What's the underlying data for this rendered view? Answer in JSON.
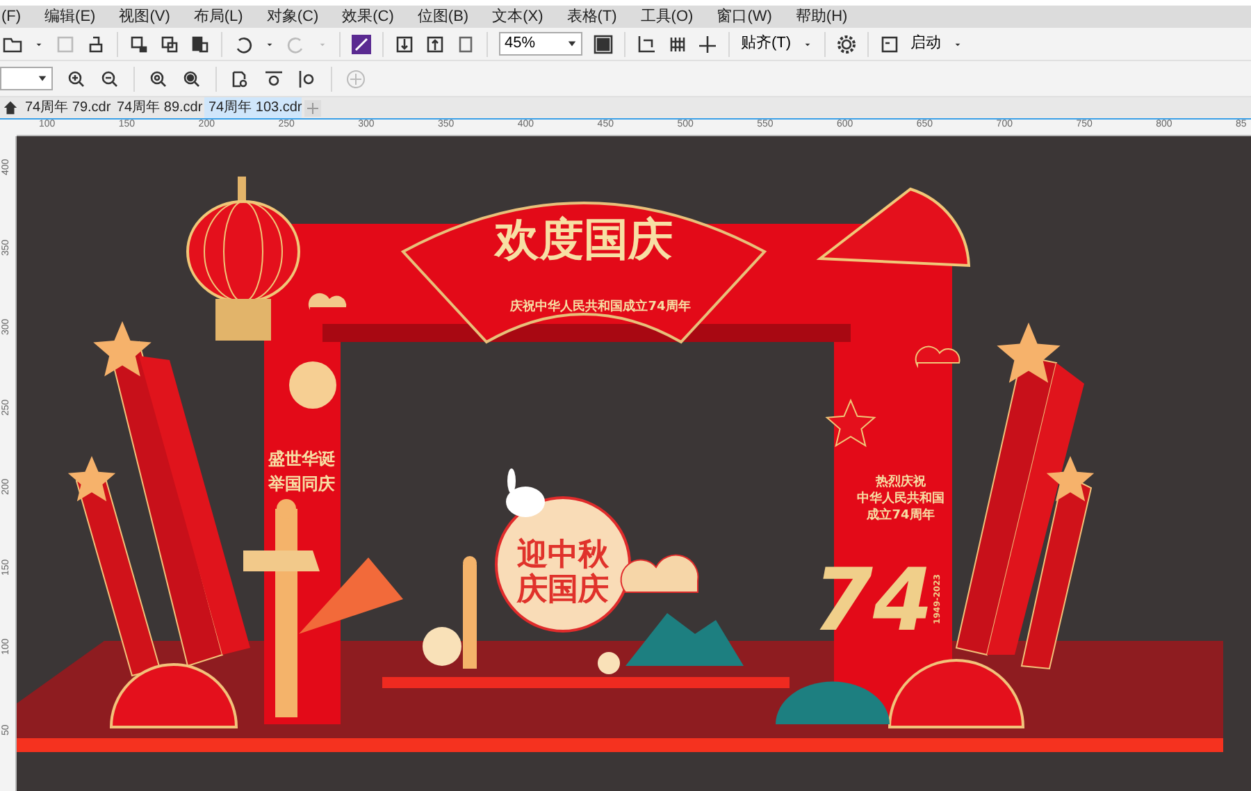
{
  "menu": [
    "(F)",
    "编辑(E)",
    "视图(V)",
    "布局(L)",
    "对象(C)",
    "效果(C)",
    "位图(B)",
    "文本(X)",
    "表格(T)",
    "工具(O)",
    "窗口(W)",
    "帮助(H)"
  ],
  "toolbar": {
    "zoom": "45%",
    "snap": "贴齐(T)",
    "launch": "启动"
  },
  "tabs": [
    {
      "label": "74周年 79.cdr",
      "selected": false
    },
    {
      "label": "74周年 89.cdr",
      "selected": false
    },
    {
      "label": "74周年 103.cdr",
      "selected": true
    }
  ],
  "ruler_h": [
    "100",
    "150",
    "200",
    "250",
    "300",
    "350",
    "400",
    "450",
    "500",
    "550",
    "600",
    "650",
    "700",
    "750",
    "800",
    "85"
  ],
  "ruler_v": [
    "400",
    "350",
    "300",
    "250",
    "200",
    "150",
    "100",
    "50"
  ],
  "artwork": {
    "title": "欢度国庆",
    "subtitle": "庆祝中华人民共和国成立74周年",
    "left_slogan": [
      "盛世华诞",
      "举国同庆"
    ],
    "right_slogan": [
      "热烈庆祝",
      "中华人民共和国",
      "成立74周年"
    ],
    "moon_text": [
      "迎中秋",
      "庆国庆"
    ],
    "number": "74",
    "years": "1949-2023"
  }
}
